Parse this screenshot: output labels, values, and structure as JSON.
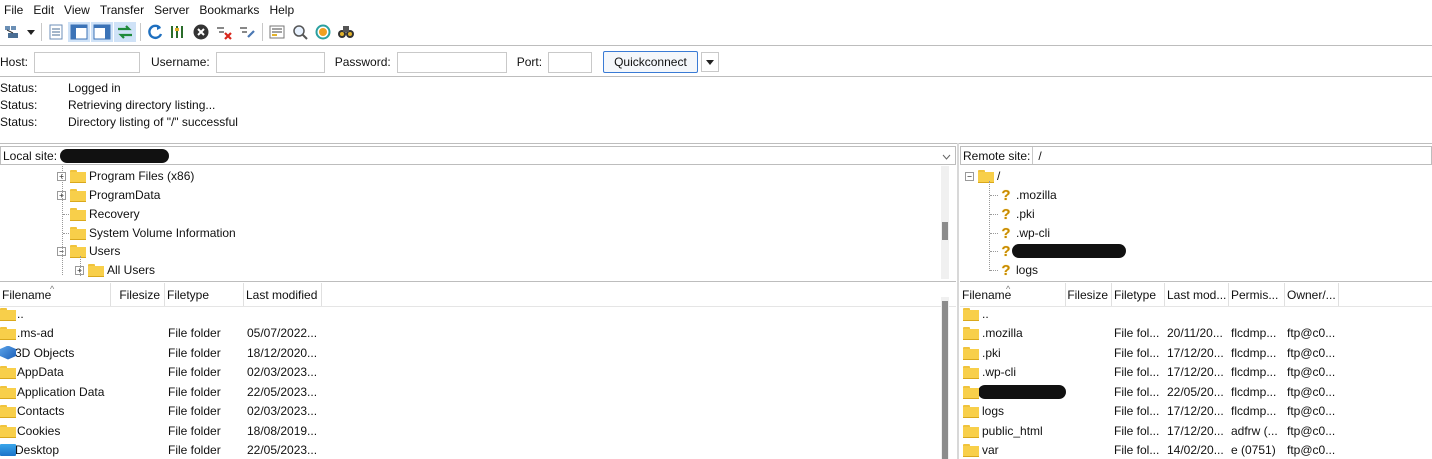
{
  "menu": [
    "File",
    "Edit",
    "View",
    "Transfer",
    "Server",
    "Bookmarks",
    "Help"
  ],
  "toolbar_icons": [
    "site-manager-icon",
    "dropdown-arrow-icon",
    "toggle-message-log-icon",
    "toggle-local-tree-icon",
    "toggle-remote-tree-icon",
    "toggle-transfer-queue-icon",
    "refresh-icon",
    "filter-icon",
    "cancel-icon",
    "disconnect-icon",
    "reconnect-icon",
    "queue-icon",
    "search-icon",
    "compare-icon",
    "find-icon"
  ],
  "quickconnect": {
    "host_label": "Host:",
    "username_label": "Username:",
    "password_label": "Password:",
    "port_label": "Port:",
    "host_value": "",
    "username_value": "",
    "password_value": "",
    "port_value": "",
    "button_label": "Quickconnect"
  },
  "log": [
    {
      "key": "Status:",
      "msg": "Logged in"
    },
    {
      "key": "Status:",
      "msg": "Retrieving directory listing..."
    },
    {
      "key": "Status:",
      "msg": "Directory listing of \"/\" successful"
    }
  ],
  "local": {
    "site_label": "Local site:",
    "tree": [
      {
        "label": "Program Files (x86)",
        "expander": "+"
      },
      {
        "label": "ProgramData",
        "expander": "+"
      },
      {
        "label": "Recovery",
        "expander": ""
      },
      {
        "label": "System Volume Information",
        "expander": ""
      },
      {
        "label": "Users",
        "expander": "−"
      },
      {
        "label": "All Users",
        "expander": "+"
      }
    ],
    "columns": [
      "Filename",
      "Filesize",
      "Filetype",
      "Last modified"
    ],
    "rows": [
      {
        "name": "..",
        "size": "",
        "type": "",
        "modified": "",
        "icon": "folder"
      },
      {
        "name": ".ms-ad",
        "size": "",
        "type": "File folder",
        "modified": "05/07/2022...",
        "icon": "folder"
      },
      {
        "name": "3D Objects",
        "size": "",
        "type": "File folder",
        "modified": "18/12/2020...",
        "icon": "3d"
      },
      {
        "name": "AppData",
        "size": "",
        "type": "File folder",
        "modified": "02/03/2023...",
        "icon": "folder"
      },
      {
        "name": "Application Data",
        "size": "",
        "type": "File folder",
        "modified": "22/05/2023...",
        "icon": "folder"
      },
      {
        "name": "Contacts",
        "size": "",
        "type": "File folder",
        "modified": "02/03/2023...",
        "icon": "folder"
      },
      {
        "name": "Cookies",
        "size": "",
        "type": "File folder",
        "modified": "18/08/2019...",
        "icon": "folder"
      },
      {
        "name": "Desktop",
        "size": "",
        "type": "File folder",
        "modified": "22/05/2023...",
        "icon": "desktop"
      }
    ]
  },
  "remote": {
    "site_label": "Remote site:",
    "site_path": "/",
    "tree_root": "/",
    "tree": [
      {
        "label": ".mozilla"
      },
      {
        "label": ".pki"
      },
      {
        "label": ".wp-cli"
      },
      {
        "label": ""
      },
      {
        "label": "logs"
      }
    ],
    "columns": [
      "Filename",
      "Filesize",
      "Filetype",
      "Last mod...",
      "Permis...",
      "Owner/..."
    ],
    "rows": [
      {
        "name": "..",
        "type": "",
        "modified": "",
        "perms": "",
        "owner": "",
        "icon": "folder"
      },
      {
        "name": ".mozilla",
        "type": "File fol...",
        "modified": "20/11/20...",
        "perms": "flcdmp...",
        "owner": "ftp@c0...",
        "icon": "folder"
      },
      {
        "name": ".pki",
        "type": "File fol...",
        "modified": "17/12/20...",
        "perms": "flcdmp...",
        "owner": "ftp@c0...",
        "icon": "folder"
      },
      {
        "name": ".wp-cli",
        "type": "File fol...",
        "modified": "17/12/20...",
        "perms": "flcdmp...",
        "owner": "ftp@c0...",
        "icon": "folder"
      },
      {
        "name": "",
        "type": "File fol...",
        "modified": "22/05/20...",
        "perms": "flcdmp...",
        "owner": "ftp@c0...",
        "icon": "folder"
      },
      {
        "name": "logs",
        "type": "File fol...",
        "modified": "17/12/20...",
        "perms": "flcdmp...",
        "owner": "ftp@c0...",
        "icon": "folder"
      },
      {
        "name": "public_html",
        "type": "File fol...",
        "modified": "17/12/20...",
        "perms": "adfrw (...",
        "owner": "ftp@c0...",
        "icon": "folder"
      },
      {
        "name": "var",
        "type": "File fol...",
        "modified": "14/02/20...",
        "perms": "e (0751)",
        "owner": "ftp@c0...",
        "icon": "folder"
      }
    ]
  }
}
